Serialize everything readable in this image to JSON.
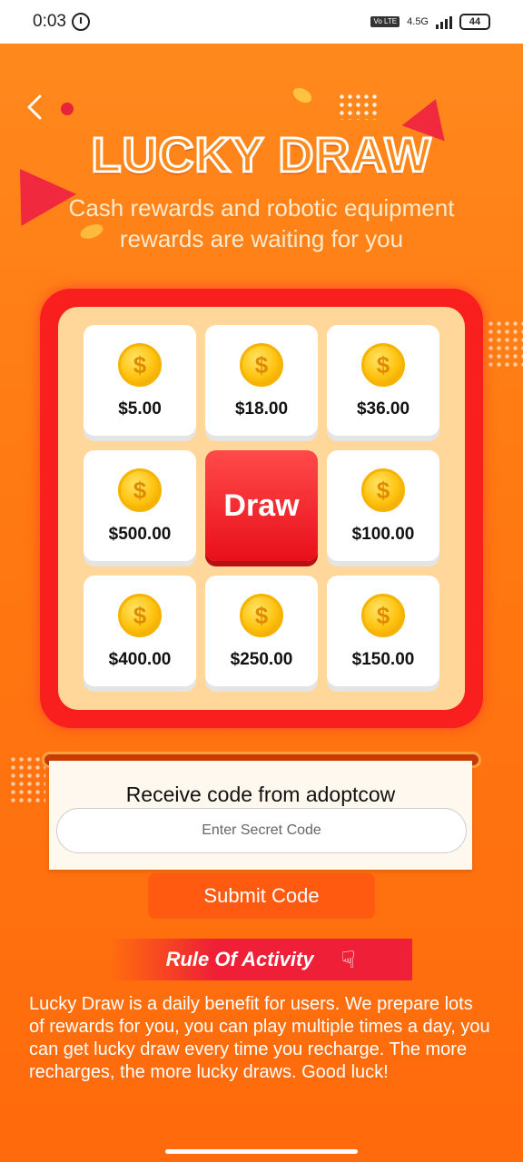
{
  "status_bar": {
    "time": "0:03",
    "network": "4.5G",
    "battery": "44",
    "volte": "Vo LTE"
  },
  "header": {
    "title": "LUCKY DRAW",
    "subtitle": "Cash rewards and robotic equipment rewards are waiting for you"
  },
  "grid": {
    "coin_symbol": "$",
    "cells": [
      {
        "amount": "$5.00"
      },
      {
        "amount": "$18.00"
      },
      {
        "amount": "$36.00"
      },
      {
        "amount": "$500.00"
      },
      {
        "amount": "$100.00"
      },
      {
        "amount": "$400.00"
      },
      {
        "amount": "$250.00"
      },
      {
        "amount": "$150.00"
      }
    ],
    "draw_label": "Draw"
  },
  "code_card": {
    "title": "Receive code from adoptcow",
    "placeholder": "Enter Secret Code",
    "value": "",
    "submit_label": "Submit Code"
  },
  "rules": {
    "title": "Rule Of Activity",
    "icon": "hand-pointer-icon",
    "text": "Lucky Draw is a daily benefit for users. We prepare lots of rewards for you, you can play multiple times a day, you can get lucky draw every time you recharge. The more recharges, the more lucky draws. Good luck!"
  },
  "colors": {
    "background": "#ff7a12",
    "board": "#fa1f1f",
    "draw": "#e8101a",
    "submit": "#ff5a10"
  }
}
